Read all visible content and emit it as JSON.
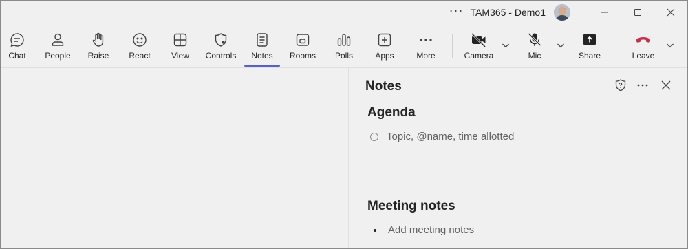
{
  "titlebar": {
    "more_glyph": "···",
    "title": "TAM365 - Demo1",
    "controls": [
      "minimize",
      "maximize",
      "close"
    ]
  },
  "toolbar": {
    "items": [
      {
        "label": "Chat",
        "icon": "chat-icon"
      },
      {
        "label": "People",
        "icon": "people-icon"
      },
      {
        "label": "Raise",
        "icon": "raise-hand-icon"
      },
      {
        "label": "React",
        "icon": "react-emoji-icon"
      },
      {
        "label": "View",
        "icon": "view-grid-icon"
      },
      {
        "label": "Controls",
        "icon": "controls-shield-icon"
      },
      {
        "label": "Notes",
        "icon": "notes-icon",
        "active": true
      },
      {
        "label": "Rooms",
        "icon": "rooms-icon"
      },
      {
        "label": "Polls",
        "icon": "polls-icon"
      },
      {
        "label": "Apps",
        "icon": "apps-icon"
      },
      {
        "label": "More",
        "icon": "more-icon"
      },
      {
        "label": "Camera",
        "icon": "camera-off-icon"
      },
      {
        "label": "Mic",
        "icon": "mic-off-icon"
      },
      {
        "label": "Share",
        "icon": "share-icon"
      },
      {
        "label": "Leave",
        "icon": "leave-phone-icon"
      }
    ],
    "accent_color": "#5b5fc7",
    "leave_color": "#c4314b"
  },
  "notes_panel": {
    "title": "Notes",
    "agenda": {
      "heading": "Agenda",
      "placeholder": "Topic, @name, time allotted"
    },
    "meeting_notes": {
      "heading": "Meeting notes",
      "placeholder": "Add meeting notes"
    }
  }
}
